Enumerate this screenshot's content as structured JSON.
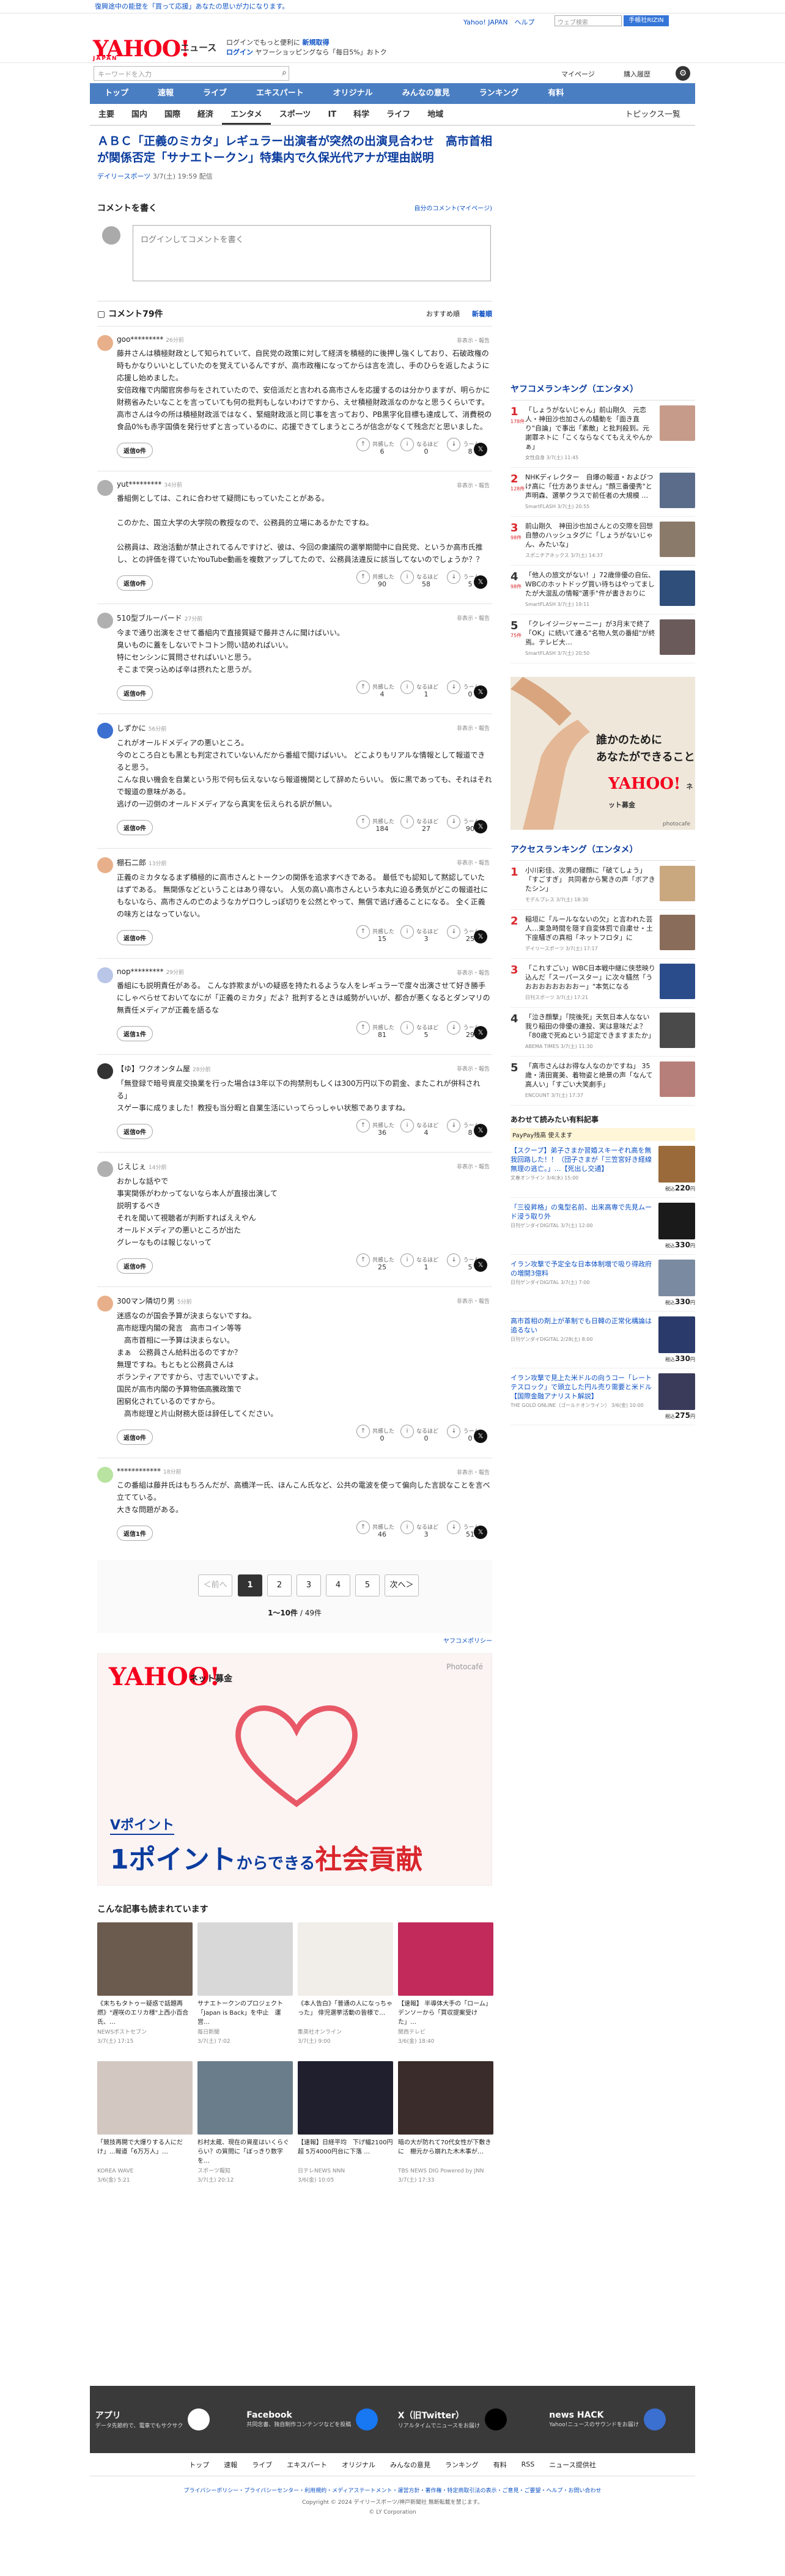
{
  "promo_top": "復興途中の能登を「買って応援」あなたの思いが力になります。",
  "header": {
    "logo": "YAHOO!",
    "logo_sub": "JAPAN",
    "section": "ニュース",
    "promo_line1": "ログインでもっと便利に",
    "promo_line1_b": "新規取得",
    "promo_line2_a": "ログイン",
    "promo_line2_b": "ヤフーショッピングなら「毎日5%」おトク",
    "links": "Yahoo! JAPAN　ヘルプ",
    "search_placeholder": "ウェブ検索",
    "search_btn": "手帳社RIZIN"
  },
  "search": {
    "placeholder": "キーワードを入力",
    "mypage": "マイページ",
    "rec": "購入履歴"
  },
  "nav1": [
    "トップ",
    "速報",
    "ライブ",
    "エキスパート",
    "オリジナル",
    "みんなの意見",
    "ランキング",
    "有料"
  ],
  "nav2": [
    "主要",
    "国内",
    "国際",
    "経済",
    "エンタメ",
    "スポーツ",
    "IT",
    "科学",
    "ライフ",
    "地域"
  ],
  "nav2_right": "トピックス一覧",
  "article": {
    "title": "ＡＢＣ「正義のミカタ」レギュラー出演者が突然の出演見合わせ　高市首相が関係否定「サナエトークン」特集内で久保光代アナが理由説明",
    "source": "デイリースポーツ",
    "date": "3/7(土) 19:59 配信"
  },
  "comment_form": {
    "heading": "コメントを書く",
    "link": "自分のコメント(マイページ)",
    "placeholder": "ログインしてコメントを書く"
  },
  "comments_header": {
    "title": "コメント79件",
    "sort1": "おすすめ順",
    "sort2": "新着順"
  },
  "reaction_labels": {
    "a": "共感した",
    "b": "なるほど",
    "c": "うーん"
  },
  "reply_label": "返信",
  "report_label": "非表示・報告",
  "comments": [
    {
      "user": "goo*********",
      "time": "26分前",
      "text": "藤井さんは積極財政として知られていて、自民党の政策に対して経済を積極的に後押し強くしており、石破政権の時もかなりいいとしていたのを覚えているんですが、高市政権になってからは言を流し、手のひらを返したように応援し始めました。\n安倍政権で内閣官房参与をされていたので、安倍派だと言われる高市さんを応援するのは分かりますが、明らかに財務省みたいなことを言っていても何の批判もしないわけですから、えせ積極財政派なのかなと思うくらいです。\n高市さんは今の所は積極財政派ではなく、緊縮財政派と同じ事を言っており、PB黒字化目標も達成して、消費税の食品0%も赤字国債を発行せずと言っているのに、応援できてしまうところが信念がなくて残念だと思いました。",
      "replies": "返信0件",
      "r": [
        6,
        0,
        8
      ],
      "av": "#e8b08a"
    },
    {
      "user": "yut*********",
      "time": "34分前",
      "text": "番組側としては、これに合わせて疑問にもっていたことがある。\n\nこのかた、国立大学の大学院の教授なので、公務員的立場にあるかたですね。\n\n公務員は、政治活動が禁止されてるんですけど、彼は、今回の衆議院の選挙期間中に自民党、というか高市氏推し、との評価を得ていたYouTube動画を複数アップしてたので、公務員法違反に該当してないのでしょうか？？",
      "replies": "返信0件",
      "r": [
        90,
        58,
        5
      ],
      "av": "#b0b0b0"
    },
    {
      "user": "510型ブルーバード",
      "time": "27分前",
      "text": "今まで通り出演をさせて番組内で直接質疑で藤井さんに聞けばいい。\n臭いものに蓋をしないでトコトン問い詰めればいい。\n特にセンシンに質問させればいいと思う。\nそこまで突っ込めば辛は摂れたと思うが。",
      "replies": "返信0件",
      "r": [
        4,
        1,
        0
      ],
      "av": "#b0b0b0"
    },
    {
      "user": "しずかに",
      "time": "56分前",
      "text": "これがオールドメディアの悪いところ。\n今のところ白とも黒とも判定されていないんだから番組で聞けばいい。 どこよりもリアルな情報として報道できると思う。\nこんな良い機会を自業という形で何も伝えないなら報道機関として辞めたらいい。 仮に黒であっても、それはそれで報道の意味がある。\n逃げの一辺倒のオールドメディアなら真実を伝えられる訳が無い。",
      "replies": "返信0件",
      "r": [
        184,
        27,
        90
      ],
      "av": "#3b6fd0"
    },
    {
      "user": "棚石二郎",
      "time": "13分前",
      "text": "正義のミカタなるまず積極的に高市さんとトークンの関係を追求すべきである。 最低でも認知して黙認していたはずである。 無関係などということはあり得ない。 人気の高い高市さんという本丸に迫る勇気がどこの報道社にもないなら、高市さんの亡のようなカゲロウしっぽ切りを公然とやって、無償で逃げ通ることになる。 全く正義の味方とはなっていない。",
      "replies": "返信0件",
      "r": [
        15,
        3,
        25
      ],
      "av": "#e8b08a"
    },
    {
      "user": "nop*********",
      "time": "29分前",
      "text": "番組にも説明責任がある。 こんな詐欺まがいの疑惑を持たれるような人をレギュラーで度々出演させて好き勝手にしゃべらせておいてなにが「正義のミカタ」だよ？批判するときは威勢がいいが、都合が悪くなるとダンマリの無責任メディアが正義を語るな",
      "replies": "返信1件",
      "r": [
        81,
        5,
        29
      ],
      "av": "#b9c6e8"
    },
    {
      "user": "【ゆ】ワクオンタム屋",
      "time": "28分前",
      "text": "「無登録で暗号資産交換業を行った場合は3年以下の拘禁刑もしくは300万円以下の罰金、またこれが併科される」\nスゲー事に成りました！教授も当分暇と自業生活にいってらっしゃい状態でありますね。",
      "replies": "返信0件",
      "r": [
        36,
        4,
        8
      ],
      "av": "#333333"
    },
    {
      "user": "じえじぇ",
      "time": "14分前",
      "text": "おかしな話やで\n事実関係がわかってないなら本人が直接出演して\n説明するべき\nそれを聞いて視聴者が判断すればええやん\nオールドメディアの悪いところが出た\nグレーなものは報じないって",
      "replies": "返信0件",
      "r": [
        25,
        1,
        5
      ],
      "av": "#b0b0b0"
    },
    {
      "user": "300マン隣切り男",
      "time": "5分前",
      "text": "迷惑なのが国会予算が決まらないですね。\n高市総理内閣の発言　高市コイン等等\n　高市首相に一予算は決まらない。\nまぁ　公務員さん給料出るのですか？\n無理ですね。もともと公務員さんは\nボランティアですから、寸志でいいですよ。\n国民が高市内閣の予算物価高騰政策で\n困窮化されているのですから。\n　高市総理と片山財務大臣は辞任してください。",
      "replies": "返信0件",
      "r": [
        0,
        0,
        0
      ],
      "av": "#e8b08a"
    },
    {
      "user": "************",
      "time": "18分前",
      "text": "この番組は藤井氏はもちろんだが、高橋洋一氏、ほんこん氏など、公共の電波を使って偏向した言説なことを言べ立てている。\n大きな問題がある。",
      "replies": "返信1件",
      "r": [
        46,
        3,
        51
      ],
      "av": "#b8e3a0"
    }
  ],
  "pager": {
    "prev": "＜前へ",
    "pages": [
      "1",
      "2",
      "3",
      "4",
      "5"
    ],
    "next": "次へ＞",
    "count_bold": "1〜10件",
    "count": "/ 49件"
  },
  "yahoo_policy": "ヤフコメポリシー",
  "big_ad": {
    "logo": "YAHOO!",
    "logo2": "ネット募金",
    "photo": "Photocafé",
    "point1": "Vポイント",
    "point2a": "1ポイント",
    "point2b": "からできる",
    "point2c": "社会貢献"
  },
  "related_heading": "こんな記事も読まれています",
  "related": [
    {
      "t": "《末ちもタトゥー疑惑で話題再燃》\"遅咲のエリカ様\"上西小百合氏、…",
      "s": "NEWSポストセブン\n3/7(土) 17:15",
      "c": "#6b5a4e"
    },
    {
      "t": "サナエトークンのプロジェクト「Japan is Back」を中止　運営…",
      "s": "毎日新聞\n3/7(土) 7:02",
      "c": "#d8d8d8"
    },
    {
      "t": "《本人告白》「普通の人になっちゃった」 俳児選挙活動の皆様で…",
      "s": "集英社オンライン\n3/7(土) 9:00",
      "c": "#f1ede8"
    },
    {
      "t": "【速報】 半導体大手の「ローム」 デンソーから「買収提案受けた」…",
      "s": "関西テレビ\n3/6(金) 18:40",
      "c": "#c22a5b"
    },
    {
      "t": "「競技再開で大爆りする人にだけ」...報道「6万万人」…",
      "s": "KOREA WAVE\n3/6(金) 5:21",
      "c": "#d3c7c2"
    },
    {
      "t": "杉村太蔵、現在の資産はいくらぐらい？の質問に「ぼっきり数字を…",
      "s": "スポーツ報知\n3/7(土) 20:12",
      "c": "#6a7d8a"
    },
    {
      "t": "【速報】日経平均　下げ幅2100円超 5万4000円台に下落 …",
      "s": "日テレNEWS NNN\n3/6(金) 10:05",
      "c": "#1f1f2e"
    },
    {
      "t": "暗の大が防れて70代女性が下敷きに　棚元から崩れた木木事が…",
      "s": "TBS NEWS DIG Powered by JNN\n3/7(土) 17:33",
      "c": "#3a2c2a"
    }
  ],
  "ranking_entame": {
    "heading": "ヤフコメランキング（エンタメ）",
    "items": [
      {
        "n": "1",
        "c": "178件",
        "t": "「しょうがないじゃん」前山剛久　元恋人・神田沙也加さんの騒動を「面き直り\"自論」で事出「素敵」と批判殺到。元謝罪ネトに「こくならなくてもええやんかぁ」",
        "s": "女性自身 3/7(土) 11:45",
        "col": "#c79b8a"
      },
      {
        "n": "2",
        "c": "128件",
        "t": "NHKディレクター　自爆の報道・およびつけ高に「仕方ありません」\"顔三番優秀\"と声明森、選挙クラスで前任者の大規模 …",
        "s": "SmartFLASH 3/7(土) 20:55",
        "col": "#5a6c8a"
      },
      {
        "n": "3",
        "c": "98件",
        "t": "前山剛久　神田沙也加さんとの交際を回想　自憩のハッシュタグに「しょうがないじゃん、みたいな」",
        "s": "スポニチアネックス 3/7(土) 14:37",
        "col": "#8a7a6a"
      },
      {
        "n": "4",
        "c": "98件",
        "t": "「他人の旅文がない！」72歳俳優の自伝、WBCのホットドッグ買い待ちはやってましたが大混乱の情報\"選手\"件が書きおりに",
        "s": "SmartFLASH 3/7(土) 19:11",
        "col": "#2f4e7a"
      },
      {
        "n": "5",
        "c": "75件",
        "t": "「クレイジージャーニー」が3月末で終了「OK」に続いて連る\"名物人気の番組\"が終焉。テレビ大…",
        "s": "SmartFLASH 3/7(土) 20:50",
        "col": "#6a5a5a"
      }
    ]
  },
  "side_ad": {
    "t1": "誰かのために\nあなたができること",
    "logo": "YAHOO!",
    "logo2": "ネット募金",
    "photo": "photocafe"
  },
  "ranking_access": {
    "heading": "アクセスランキング（エンタメ）",
    "items": [
      {
        "n": "1",
        "t": "小川彩佳、次男の寝顔に「破てしょう」「すごすぎ」 共同者から驚きの声「ボアきたシン」",
        "s": "モデルプレス 3/7(土) 18:30",
        "col": "#c9a77f"
      },
      {
        "n": "2",
        "t": "稲垣に「ルールなないの欠」と言われた芸人…東急時間を隠す自変体罰で自粛せ・土下座騒ぎの真相「ネットフロタ」に",
        "s": "デイリースポーツ 3/7(土) 17:17",
        "col": "#8a6c5a"
      },
      {
        "n": "3",
        "t": "「これすごい」WBC日本戦中継に侠悲映り込んだ「スーパースター」に次々騒然「うおおおおおおおおー」\"本気になる",
        "s": "日刊スポーツ 3/7(土) 17:21",
        "col": "#2b4c8a"
      },
      {
        "n": "4",
        "t": "「泣き顔撃」「院後死」天気日本人なない我り稲田の俳優の連投、実は意味だよ？ 「80歳で死ぬという認定できますまたか」",
        "s": "ABEMA TIMES 3/7(土) 11:30",
        "col": "#4a4a4a"
      },
      {
        "n": "5",
        "t": "「高市さんはお得な人なのかですね」 35歳・清田寛美、着物姿と絶景の声「なんて高人い」「すごい大笑劇手」",
        "s": "ENCOUNT 3/7(土) 17:37",
        "col": "#b77f7a"
      }
    ]
  },
  "shop": {
    "heading": "あわせて読みたい有料記事",
    "paypay": "PayPay残高 使えます",
    "items": [
      {
        "t": "【スクープ】弟子さまか習婚スキーぞれ高を無我回路した！！（団子さまが「三笠宮好き経線無理の逃亡。」…【死出し交通】",
        "s": "文春オンライン 3/4(水) 15:00",
        "p": "220",
        "col": "#9a6a3a"
      },
      {
        "t": "「三役昇格」の鬼型名前、出来高専で先見ムード浸う取り外",
        "s": "日刊ゲンダイDIGITAL 3/7(土) 12:00",
        "p": "330",
        "col": "#1a1a1a"
      },
      {
        "t": "イラン攻撃で予定全な日本体制増で吸り得政府の増開3億料",
        "s": "日刊ゲンダイDIGITAL 3/7(土) 7:00",
        "p": "330",
        "col": "#7a8aa0"
      },
      {
        "t": "高市首相の剤上が革制でも日韓の正常化構論は追るない",
        "s": "日刊ゲンダイDIGITAL 2/28(土) 8:00",
        "p": "330",
        "col": "#2a3a6a"
      },
      {
        "t": "イラン攻撃で見上た米ドルの向うコー「レートテスロック」で頭立した円ル売り需要と米ドル【国際金融アナリスト解説】",
        "s": "THE GOLD ONLINE（ゴールドオンライン） 3/6(金) 10:00",
        "p": "275",
        "col": "#3a3a5a"
      }
    ],
    "unit": "税込",
    "yen": "円"
  },
  "footer": {
    "apps": [
      {
        "t": "アプリ",
        "d": "データ先節約で、電車でもサクサク",
        "col": "#ffffff"
      },
      {
        "t": "Facebook",
        "d": "共同念書、独自制作コンテンツなどを投稿",
        "col": "#1877f2"
      },
      {
        "t": "X（旧Twitter）",
        "d": "リアルタイムでニュースをお届け",
        "col": "#000000"
      },
      {
        "t": "news HACK",
        "d": "Yahoo!ニュースのサウンドをお届け",
        "col": "#3b6fd0"
      }
    ],
    "nav": [
      "トップ",
      "速報",
      "ライブ",
      "エキスパート",
      "オリジナル",
      "みんなの意見",
      "ランキング",
      "有料",
      "RSS",
      "ニュース提供社"
    ],
    "links": "プライバシーポリシー・プライバシーセンター・利用規約・メディアステートメント・運営方針・著作権・特定商取引法の表示・ご意見・ご要望・ヘルプ・お問い合わせ",
    "copy": "Copyright © 2024 デイリースポーツ/神戸新聞社 無断転載を禁じます。",
    "ly": "© LY Corporation"
  }
}
